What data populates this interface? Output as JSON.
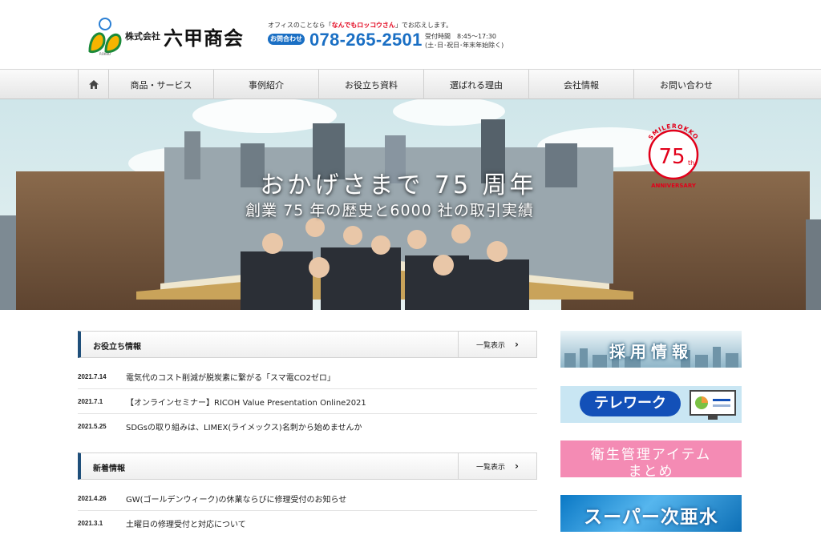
{
  "header": {
    "logo_small": "株式会社",
    "logo_big": "六甲商会",
    "tagline_pre": "オフィスのことなら「",
    "tagline_em": "なんでもロッコウさん",
    "tagline_post": "」でお応えします。",
    "phone_badge": "お問合わせ",
    "phone": "078-265-2501",
    "hours_line1": "受付時間　8:45～17:30",
    "hours_line2": "(土･日･祝日･年末年始除く)"
  },
  "nav": {
    "items": [
      {
        "label": "商品・サービス"
      },
      {
        "label": "事例紹介"
      },
      {
        "label": "お役立ち資料"
      },
      {
        "label": "選ばれる理由"
      },
      {
        "label": "会社情報"
      },
      {
        "label": "お問い合わせ"
      }
    ]
  },
  "hero": {
    "title": "おかげさまで 75 周年",
    "subtitle": "創業 75 年の歴史と6000 社の取引実績",
    "badge_arc": "SMILEROKKO",
    "badge_num": "75",
    "badge_th": "th",
    "badge_anniv": "ANNIVERSARY"
  },
  "useful": {
    "title": "お役立ち情報",
    "more": "一覧表示",
    "items": [
      {
        "date": "2021.7.14",
        "text": "電気代のコスト削減が脱炭素に繋がる「スマ電CO2ゼロ」"
      },
      {
        "date": "2021.7.1",
        "text": "【オンラインセミナー】RICOH Value Presentation Online2021"
      },
      {
        "date": "2021.5.25",
        "text": "SDGsの取り組みは、LIMEX(ライメックス)名刺から始めませんか"
      }
    ]
  },
  "news": {
    "title": "新着情報",
    "more": "一覧表示",
    "items": [
      {
        "date": "2021.4.26",
        "text": "GW(ゴールデンウィーク)の休業ならびに修理受付のお知らせ"
      },
      {
        "date": "2021.3.1",
        "text": "土曜日の修理受付と対応について"
      }
    ]
  },
  "banners": {
    "recruit": "採用情報",
    "telework": "テレワーク",
    "hygiene_line1": "衛生管理アイテム",
    "hygiene_line2": "まとめ",
    "water": "スーパー次亜水"
  },
  "colors": {
    "accent_blue": "#1a6fc4",
    "section_bar": "#1f4f7a",
    "badge_red": "#e2001a",
    "hygiene_pink": "#f48bb4"
  }
}
